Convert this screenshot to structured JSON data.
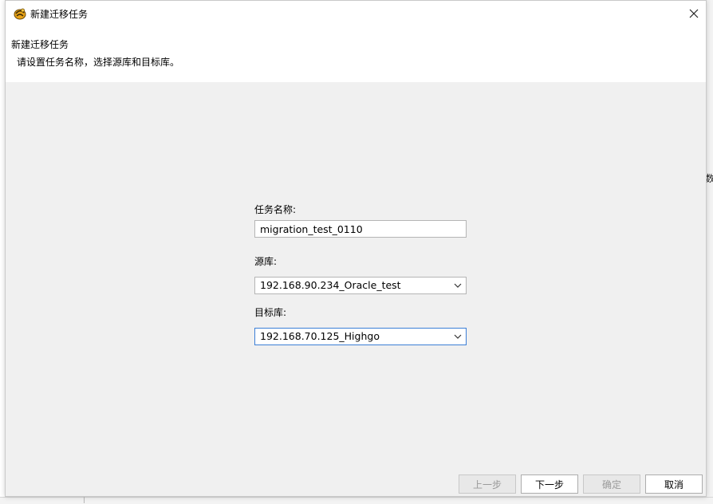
{
  "window": {
    "title": "新建迁移任务",
    "icon": "app-logo-icon"
  },
  "header": {
    "title": "新建迁移任务",
    "description": "请设置任务名称，选择源库和目标库。"
  },
  "form": {
    "task_name_label": "任务名称:",
    "task_name_value": "migration_test_0110",
    "source_label": "源库:",
    "source_value": "192.168.90.234_Oracle_test",
    "target_label": "目标库:",
    "target_value": "192.168.70.125_Highgo"
  },
  "buttons": {
    "prev": "上一步",
    "next": "下一步",
    "ok": "确定",
    "cancel": "取消"
  },
  "background": {
    "right_glyph": "数"
  },
  "colors": {
    "dialog_bg": "#f0f0f0",
    "header_bg": "#ffffff",
    "focus_border": "#3c7fd6"
  }
}
